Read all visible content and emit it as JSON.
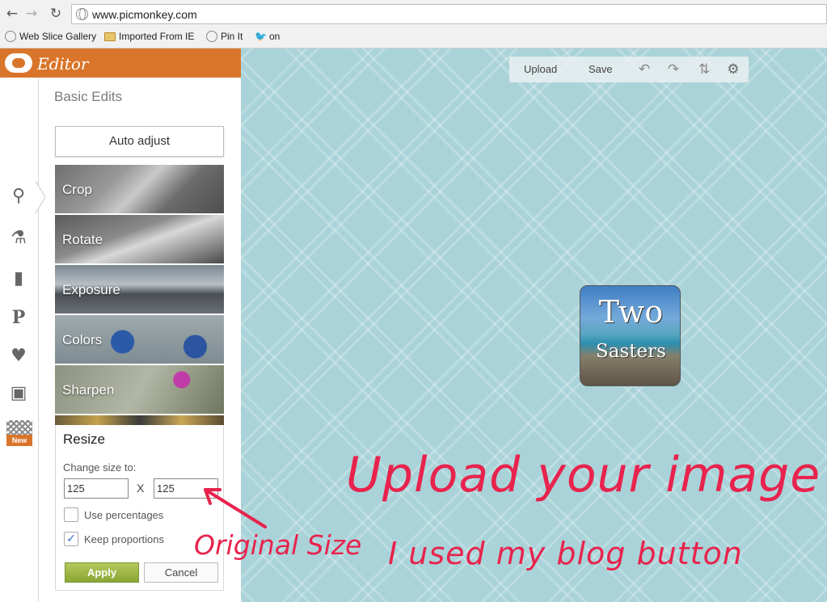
{
  "browser": {
    "url": "www.picmonkey.com",
    "bookmarks": [
      "Web Slice Gallery",
      "Imported From IE",
      "Pin It",
      "on"
    ]
  },
  "editor": {
    "logo_text": "Editor",
    "panel_title": "Basic Edits",
    "auto_adjust": "Auto adjust",
    "tiles": [
      "Crop",
      "Rotate",
      "Exposure",
      "Colors",
      "Sharpen"
    ],
    "new_badge": "New",
    "resize": {
      "title": "Resize",
      "change_label": "Change size to:",
      "width": "125",
      "height": "125",
      "x": "X",
      "use_percentages": "Use percentages",
      "keep_proportions": "Keep proportions",
      "keep_checked": true,
      "apply": "Apply",
      "cancel": "Cancel"
    }
  },
  "toolbar": {
    "upload": "Upload",
    "save": "Save"
  },
  "canvas": {
    "image_line1": "Two",
    "image_line2": "Sasters",
    "annotation_main": "Upload your image",
    "annotation_sub": "I used my blog button",
    "annotation_size": "Original Size"
  },
  "colors": {
    "brand_orange": "#d9752a",
    "canvas_bg": "#a9d3d9",
    "annotation_red": "#e8234d",
    "apply_green": "#8aa634"
  }
}
